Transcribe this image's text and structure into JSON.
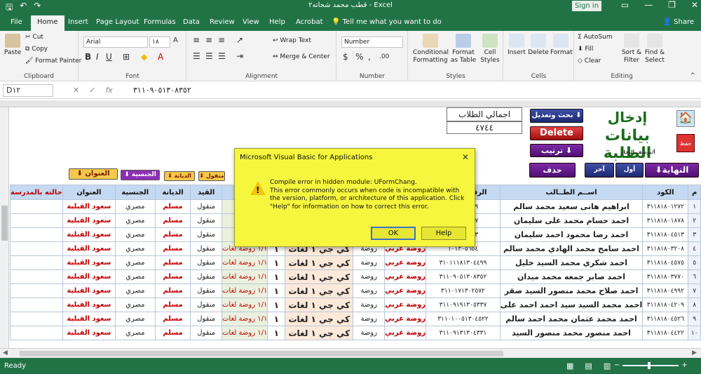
{
  "titlebar": {
    "title": "قطب محمد شحاته٢ - Excel",
    "signin": "Sign in",
    "qat_icons": [
      "save-icon",
      "undo-icon",
      "redo-icon"
    ],
    "win_buttons": [
      "—",
      "❐",
      "✕"
    ]
  },
  "ribbon_tabs": [
    "File",
    "Home",
    "Insert",
    "Page Layout",
    "Formulas",
    "Data",
    "Review",
    "View",
    "Help",
    "Acrobat"
  ],
  "active_tab": "Home",
  "tellme": "Tell me what you want to do",
  "share": "Share",
  "ribbon": {
    "clipboard": {
      "label": "Clipboard",
      "paste": "Paste",
      "cut": "Cut",
      "copy": "Copy",
      "format_painter": "Format Painter"
    },
    "font": {
      "label": "Font",
      "name": "Arial",
      "size": "١٨"
    },
    "alignment": {
      "label": "Alignment",
      "wrap": "Wrap Text",
      "merge": "Merge & Center"
    },
    "number": {
      "label": "Number",
      "format": "Number"
    },
    "styles": {
      "label": "Styles",
      "cond": "Conditional Formatting",
      "table": "Format as Table",
      "cell": "Cell Styles"
    },
    "cells": {
      "label": "Cells",
      "insert": "Insert",
      "delete": "Delete",
      "format": "Format"
    },
    "editing": {
      "label": "Editing",
      "autosum": "AutoSum",
      "fill": "Fill",
      "clear": "Clear",
      "sort": "Sort & Filter",
      "find": "Find & Select"
    }
  },
  "formula_bar": {
    "cell_ref": "D١٢",
    "formula": "٣١١٠٩٠٥١٣٠٨٣٥٢"
  },
  "top": {
    "total_label": "اجمالي الطلاب",
    "total_value": "٤٧٤٤",
    "search_btn": "بحث وتعديل",
    "delete_btn": "Delete",
    "sort_btn": "ترتيب",
    "logo_line1": "إدخال",
    "logo_line2": "بيانات الطلبة",
    "logo_sub": "أ/يوسف النجار",
    "save_icon_label": "حفظ",
    "nav_end": "النهاية",
    "nav_first": "أول طالب",
    "nav_last": "آخر طالب",
    "del_student": "حذف الطالب",
    "small_btns": [
      "العنوان",
      "الجنسية",
      "الديانة",
      "منقول"
    ]
  },
  "table": {
    "headers": [
      "حالته بالمدرسة",
      "العنوان",
      "الجنسية",
      "الديانة",
      "القيد",
      "",
      "",
      "",
      "",
      "",
      "الرقم القومي",
      "اســم الطــالب",
      "الكود",
      "م"
    ],
    "rows": [
      {
        "address": "سعود القبلية",
        "nat": "مصري",
        "rel": "مسلم",
        "status": "منقول",
        "id": "٢٦١٣٠٣٧٧٩",
        "name": "ابراهيم هانى سعيد محمد سالم",
        "code": "٣١١٨١٨٠١٢٧٢",
        "n": "١"
      },
      {
        "address": "سعود القبلية",
        "nat": "مصري",
        "rel": "مسلم",
        "status": "منقول",
        "id": "١٧١٣٠٥٨٣٧",
        "name": "احمد حسام محمد على سليمان",
        "code": "٣١١٨١٨٠١٨٧٨",
        "n": "٢"
      },
      {
        "address": "سعود القبلية",
        "nat": "مصري",
        "rel": "مسلم",
        "status": "منقول",
        "id": "١٠١٣٠١١٣٣",
        "name": "احمد رضا محمود احمد سليمان",
        "code": "٣١١٨١٨٠٤٥١٣",
        "n": "٣"
      },
      {
        "address": "سعود القبلية",
        "nat": "مصري",
        "rel": "مسلم",
        "status": "منقول",
        "id": "١٠١٣٠٥٦٥٤",
        "name": "احمد سامح محمد الهادي محمد سالم",
        "code": "٣١١٨١٨٠٣٢٠٨",
        "n": "٤",
        "g": "١/١ روضة لغات",
        "k": "١",
        "c": "كي جي ١ لغات",
        "s": "روضة",
        "ar": "روضة عربي"
      },
      {
        "address": "سعود القبلية",
        "nat": "مصري",
        "rel": "مسلم",
        "status": "منقول",
        "id": "٣١٠١١١٨١٣٠٤٤٩٩",
        "name": "احمد شكري محمد السيد خليل",
        "code": "٣١١٨١٨٠٤٥٧٥",
        "n": "٥",
        "g": "١/١ روضة لغات",
        "k": "١",
        "c": "كي جي ١ لغات",
        "s": "روضة",
        "ar": "روضة عربي"
      },
      {
        "address": "سعود القبلية",
        "nat": "مصري",
        "rel": "مسلم",
        "status": "منقول",
        "id": "٣١١٠٩٠٥١٣٠٨٣٥٢",
        "name": "احمد صابر جمعه محمد ميدان",
        "code": "٣١١٨١٨٠٣٧٧٠",
        "n": "٦",
        "g": "١/١ روضة لغات",
        "k": "١",
        "c": "كي جي ١ لغات",
        "s": "روضة",
        "ar": "روضة عربي"
      },
      {
        "address": "سعود القبلية",
        "nat": "مصري",
        "rel": "مسلم",
        "status": "منقول",
        "id": "٣١١٠١٧١٣٠٢٥٧٢",
        "name": "احمد صلاح محمد منصور السيد صقر",
        "code": "٣١١٨١٨٠٤٩٩٢",
        "n": "٧",
        "g": "١/١ روضة لغات",
        "k": "١",
        "c": "كي جي ١ لغات",
        "s": "روضة",
        "ar": "روضة عربي"
      },
      {
        "address": "سعود القبلية",
        "nat": "مصري",
        "rel": "مسلم",
        "status": "منقول",
        "id": "٣١١٠٩١٩١٣٠٥٣٣٧",
        "name": "احمد محمد السيد سيد احمد احمد على",
        "code": "٣١١٨١٨٠٤٢٠٩",
        "n": "٨",
        "g": "١/١ روضة لغات",
        "k": "١",
        "c": "كي جي ١ لغات",
        "s": "روضة",
        "ar": "روضة عربي"
      },
      {
        "address": "سعود القبلية",
        "nat": "مصري",
        "rel": "مسلم",
        "status": "منقول",
        "id": "٣١١٠١٠٠٥١٣٠٤٥٢٢",
        "name": "احمد محمد عثمان محمد احمد سالم",
        "code": "٣١١٨١٨٠٤٥٢٦",
        "n": "٩",
        "g": "١/١ روضة لغات",
        "k": "١",
        "c": "كي جي ١ لغات",
        "s": "روضة",
        "ar": "روضة عربي"
      },
      {
        "address": "سعود القبلية",
        "nat": "مصري",
        "rel": "مسلم",
        "status": "منقول",
        "id": "٣١١٠٩١٣١٣٠٤٣٣١",
        "name": "احمد منصور محمد منصور السيد",
        "code": "٣١١٨١٨٠٤٤٢٢",
        "n": "١٠",
        "g": "١/١ روضة لغات",
        "k": "١",
        "c": "كي جي ١ لغات",
        "s": "روضة",
        "ar": "روضة عربي"
      }
    ]
  },
  "dialog": {
    "title": "Microsoft Visual Basic for Applications",
    "line1": "Compile error in hidden module: UFormChang.",
    "line2": "This error commonly occurs when code is incompatible with the version, platform, or architecture of this application.  Click \"Help\" for information on how to correct this error.",
    "ok": "OK",
    "help": "Help"
  },
  "status": {
    "ready": "Ready"
  },
  "colors": {
    "excel_green": "#217346",
    "dialog_yellow": "#f6f63e",
    "header_blue": "#c5d9f1",
    "red_text": "#c00000"
  }
}
